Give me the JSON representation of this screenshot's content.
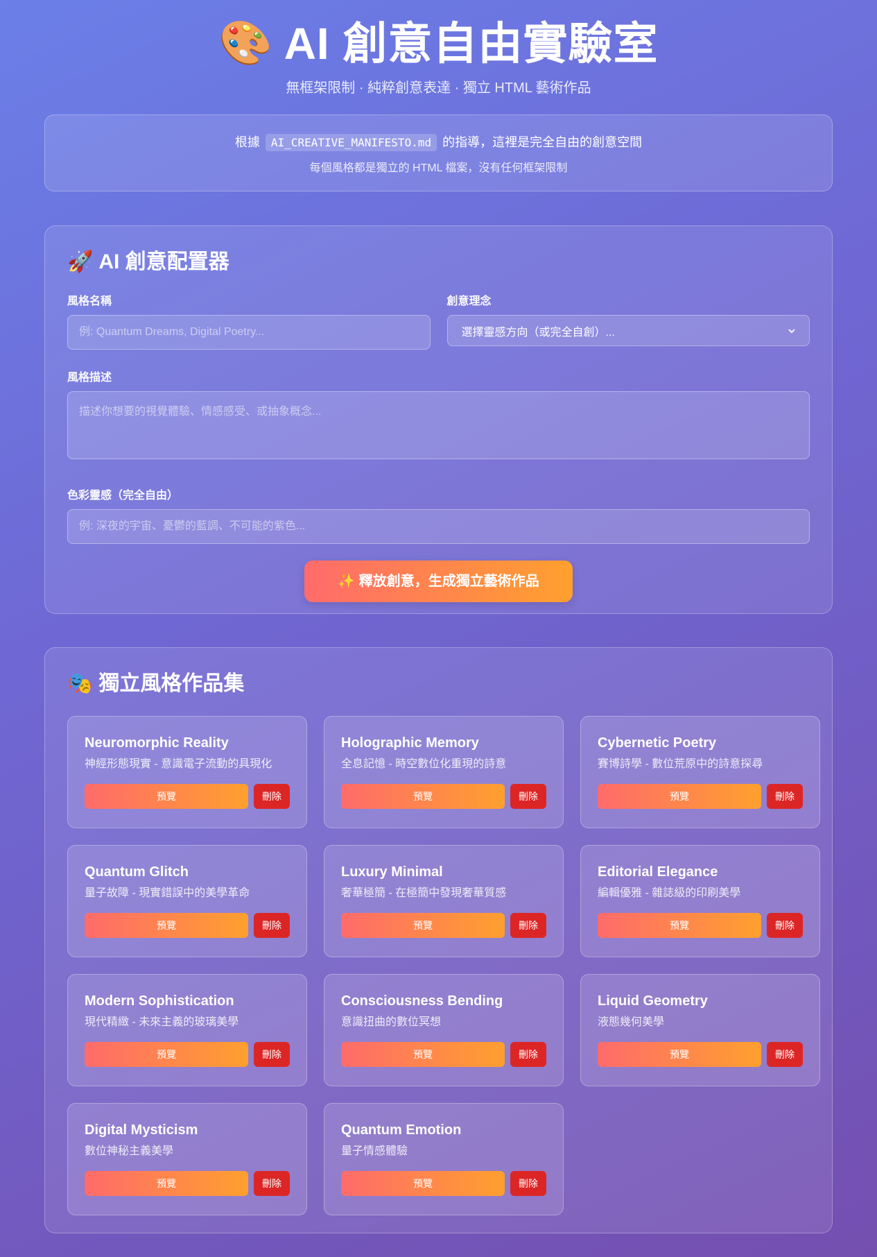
{
  "header": {
    "icon": "🎨",
    "title": "AI 創意自由實驗室",
    "subtitle": "無框架限制 · 純粹創意表達 · 獨立 HTML 藝術作品"
  },
  "manifest": {
    "prefix": "根據",
    "filename": "AI_CREATIVE_MANIFESTO.md",
    "suffix": "的指導，這裡是完全自由的創意空間",
    "note": "每個風格都是獨立的 HTML 檔案，沒有任何框架限制"
  },
  "config": {
    "icon": "🚀",
    "title": "AI 創意配置器",
    "style_name": {
      "label": "風格名稱",
      "placeholder": "例: Quantum Dreams, Digital Poetry...",
      "value": ""
    },
    "concept": {
      "label": "創意理念",
      "selected": "選擇靈感方向（或完全自創）..."
    },
    "description": {
      "label": "風格描述",
      "placeholder": "描述你想要的視覺體驗、情感感受、或抽象概念...",
      "value": ""
    },
    "color": {
      "label": "色彩靈感（完全自由）",
      "placeholder": "例: 深夜的宇宙、憂鬱的藍調、不可能的紫色...",
      "value": ""
    },
    "generate_label": "✨ 釋放創意，生成獨立藝術作品"
  },
  "gallery": {
    "icon": "🎭",
    "title": "獨立風格作品集",
    "preview_label": "預覽",
    "delete_label": "刪除",
    "items": [
      {
        "title": "Neuromorphic Reality",
        "desc": "神經形態現實 - 意識電子流動的具現化"
      },
      {
        "title": "Holographic Memory",
        "desc": "全息記憶 - 時空數位化重現的詩意"
      },
      {
        "title": "Cybernetic Poetry",
        "desc": "賽博詩學 - 數位荒原中的詩意探尋"
      },
      {
        "title": "Quantum Glitch",
        "desc": "量子故障 - 現實錯誤中的美學革命"
      },
      {
        "title": "Luxury Minimal",
        "desc": "奢華極簡 - 在極簡中發現奢華質感"
      },
      {
        "title": "Editorial Elegance",
        "desc": "編輯優雅 - 雜誌級的印刷美學"
      },
      {
        "title": "Modern Sophistication",
        "desc": "現代精緻 - 未來主義的玻璃美學"
      },
      {
        "title": "Consciousness Bending",
        "desc": "意識扭曲的數位冥想"
      },
      {
        "title": "Liquid Geometry",
        "desc": "液態幾何美學"
      },
      {
        "title": "Digital Mysticism",
        "desc": "數位神秘主義美學"
      },
      {
        "title": "Quantum Emotion",
        "desc": "量子情感體驗"
      }
    ]
  }
}
